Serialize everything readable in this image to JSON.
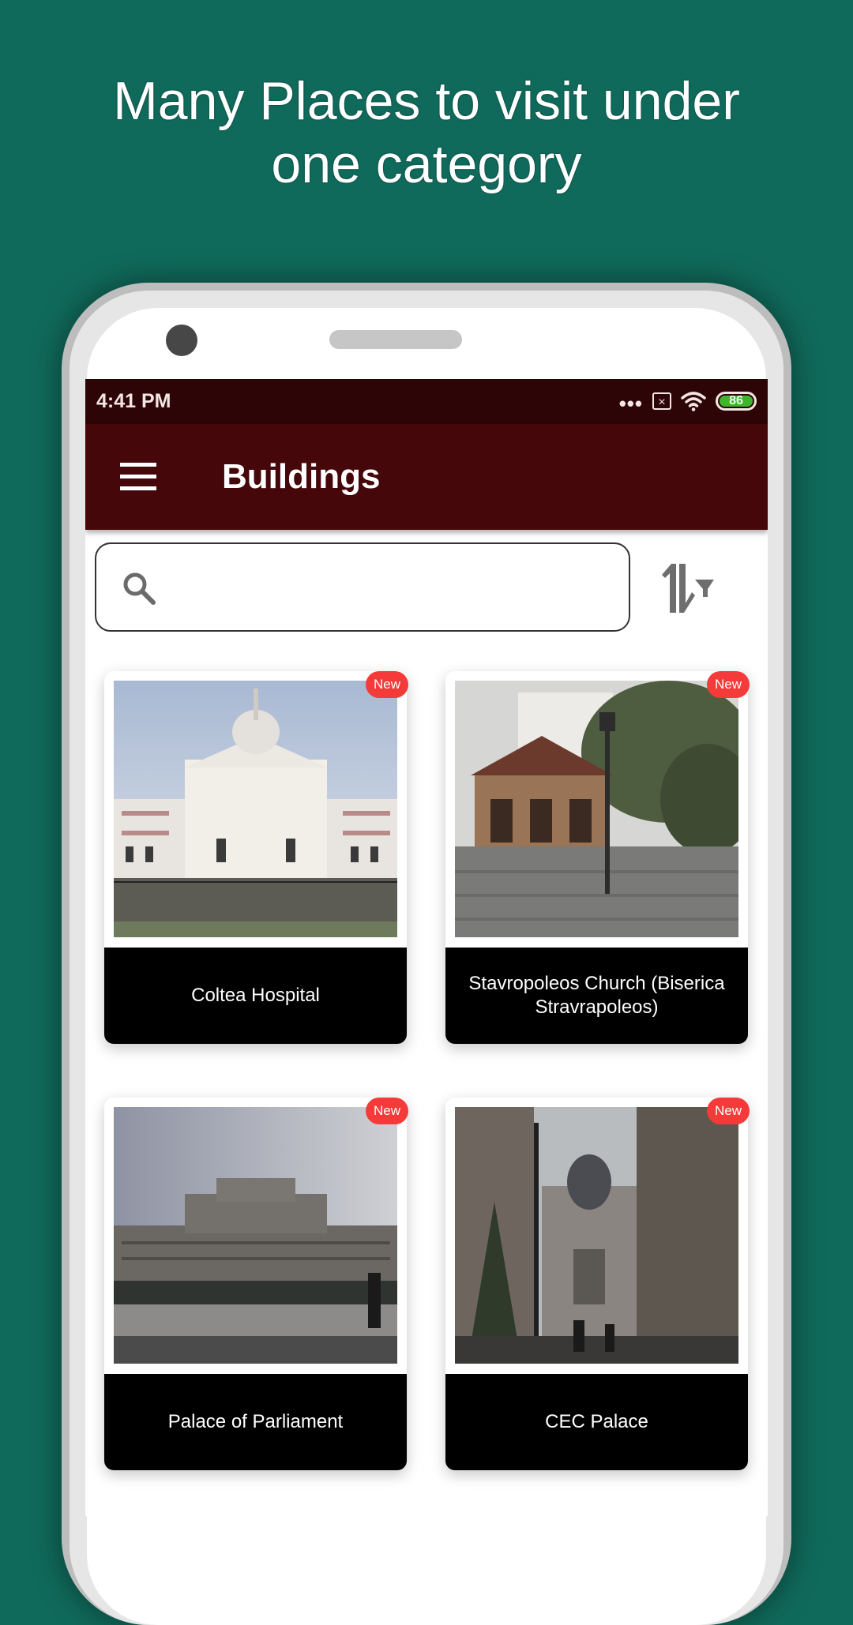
{
  "promo": {
    "headline_line1": "Many Places to visit under",
    "headline_line2": "one category"
  },
  "colors": {
    "background": "#106a5b",
    "status_bar": "#2e0506",
    "app_bar": "#450709",
    "badge": "#f53a3a",
    "battery_fill": "#3fb52c"
  },
  "status_bar": {
    "time": "4:41 PM",
    "overflow_dots": "•••",
    "sim_icon": "no-sim-icon",
    "wifi_icon": "wifi-icon",
    "battery_level": "86"
  },
  "app_bar": {
    "menu_icon": "hamburger-menu-icon",
    "title": "Buildings"
  },
  "search": {
    "icon": "search-icon",
    "value": "",
    "placeholder": ""
  },
  "sort": {
    "icon": "sort-filter-icon"
  },
  "places": [
    {
      "name": "Coltea Hospital",
      "badge": "New",
      "image": "coltea-hospital-photo"
    },
    {
      "name": "Stavropoleos Church (Biserica Stravrapoleos)",
      "badge": "New",
      "image": "stavropoleos-church-photo"
    },
    {
      "name": "Palace of Parliament",
      "badge": "New",
      "image": "palace-of-parliament-photo"
    },
    {
      "name": "CEC Palace",
      "badge": "New",
      "image": "cec-palace-photo"
    }
  ]
}
